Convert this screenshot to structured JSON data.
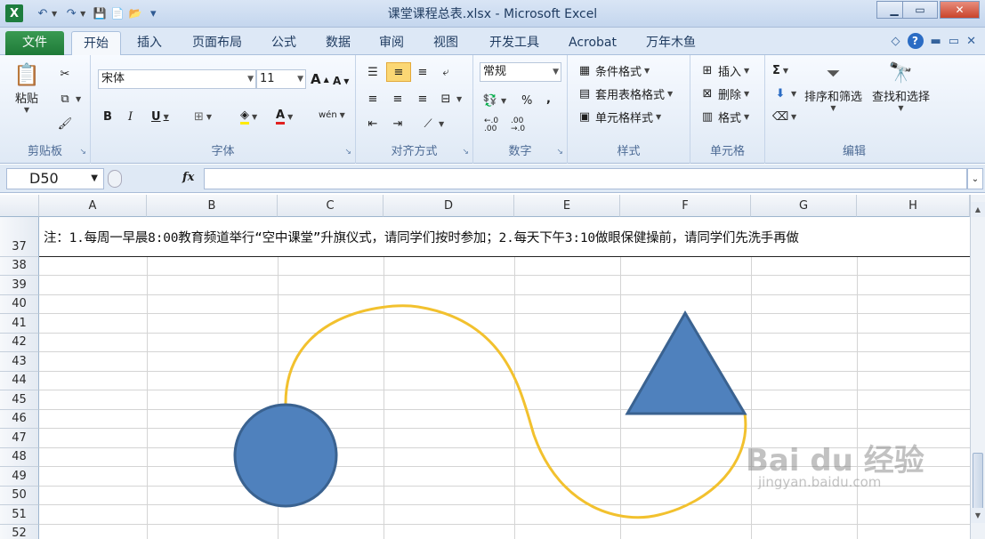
{
  "window": {
    "title": "课堂课程总表.xlsx - Microsoft Excel",
    "controls": {
      "minimize": "▁",
      "maximize": "▭",
      "close": "✕"
    }
  },
  "qat": {
    "logo": "X",
    "undo": "↶",
    "redo": "↷",
    "save": "💾",
    "new": "📄",
    "open": "📂",
    "customize": "▾"
  },
  "tabs": [
    "文件",
    "开始",
    "插入",
    "页面布局",
    "公式",
    "数据",
    "审阅",
    "视图",
    "开发工具",
    "Acrobat",
    "万年木鱼"
  ],
  "active_tab": "开始",
  "tab_right": {
    "minimize_ribbon": "◇",
    "help": "?",
    "restore": "▭",
    "close": "✕"
  },
  "ribbon": {
    "clipboard": {
      "label": "剪贴板",
      "paste": "粘贴",
      "paste_icon": "📋",
      "cut_icon": "✂",
      "copy_icon": "⧉",
      "format_painter_icon": "🖌"
    },
    "font": {
      "label": "字体",
      "font_name": "宋体",
      "font_size": "11",
      "grow": "A",
      "shrink": "A",
      "bold": "B",
      "italic": "I",
      "underline": "U",
      "border": "⊞",
      "fill": "◈",
      "font_color": "A",
      "phonetic": "wén"
    },
    "alignment": {
      "label": "对齐方式"
    },
    "number": {
      "label": "数字",
      "format": "常规",
      "percent": "%",
      "comma": ",",
      "inc_decimal": "←.0\n.00",
      "dec_decimal": ".00\n→.0"
    },
    "styles": {
      "label": "样式",
      "conditional": "条件格式",
      "table": "套用表格格式",
      "cell": "单元格样式"
    },
    "cells": {
      "label": "单元格",
      "insert": "插入",
      "delete": "删除",
      "format": "格式"
    },
    "editing": {
      "label": "编辑",
      "sum": "Σ",
      "sort_filter": "排序和筛选",
      "find_select": "查找和选择"
    }
  },
  "formula_bar": {
    "name_box": "D50",
    "fx": "fx",
    "formula": ""
  },
  "sheet": {
    "columns": [
      "A",
      "B",
      "C",
      "D",
      "E",
      "F",
      "G",
      "H"
    ],
    "rows": [
      "37",
      "38",
      "39",
      "40",
      "41",
      "42",
      "43",
      "44",
      "45",
      "46",
      "47",
      "48",
      "49",
      "50",
      "51",
      "52"
    ],
    "note": "注：1.每周一早晨8:00教育频道举行“空中课堂”升旗仪式，请同学们按时参加；2.每天下午3:10做眼保健操前，请同学们先洗手再做"
  },
  "shape_colors": {
    "fill": "#4f81bd",
    "stroke": "#3a6290",
    "curve": "#f2c12e"
  },
  "watermark": {
    "main": "Bai du 经验",
    "sub": "jingyan.baidu.com"
  }
}
